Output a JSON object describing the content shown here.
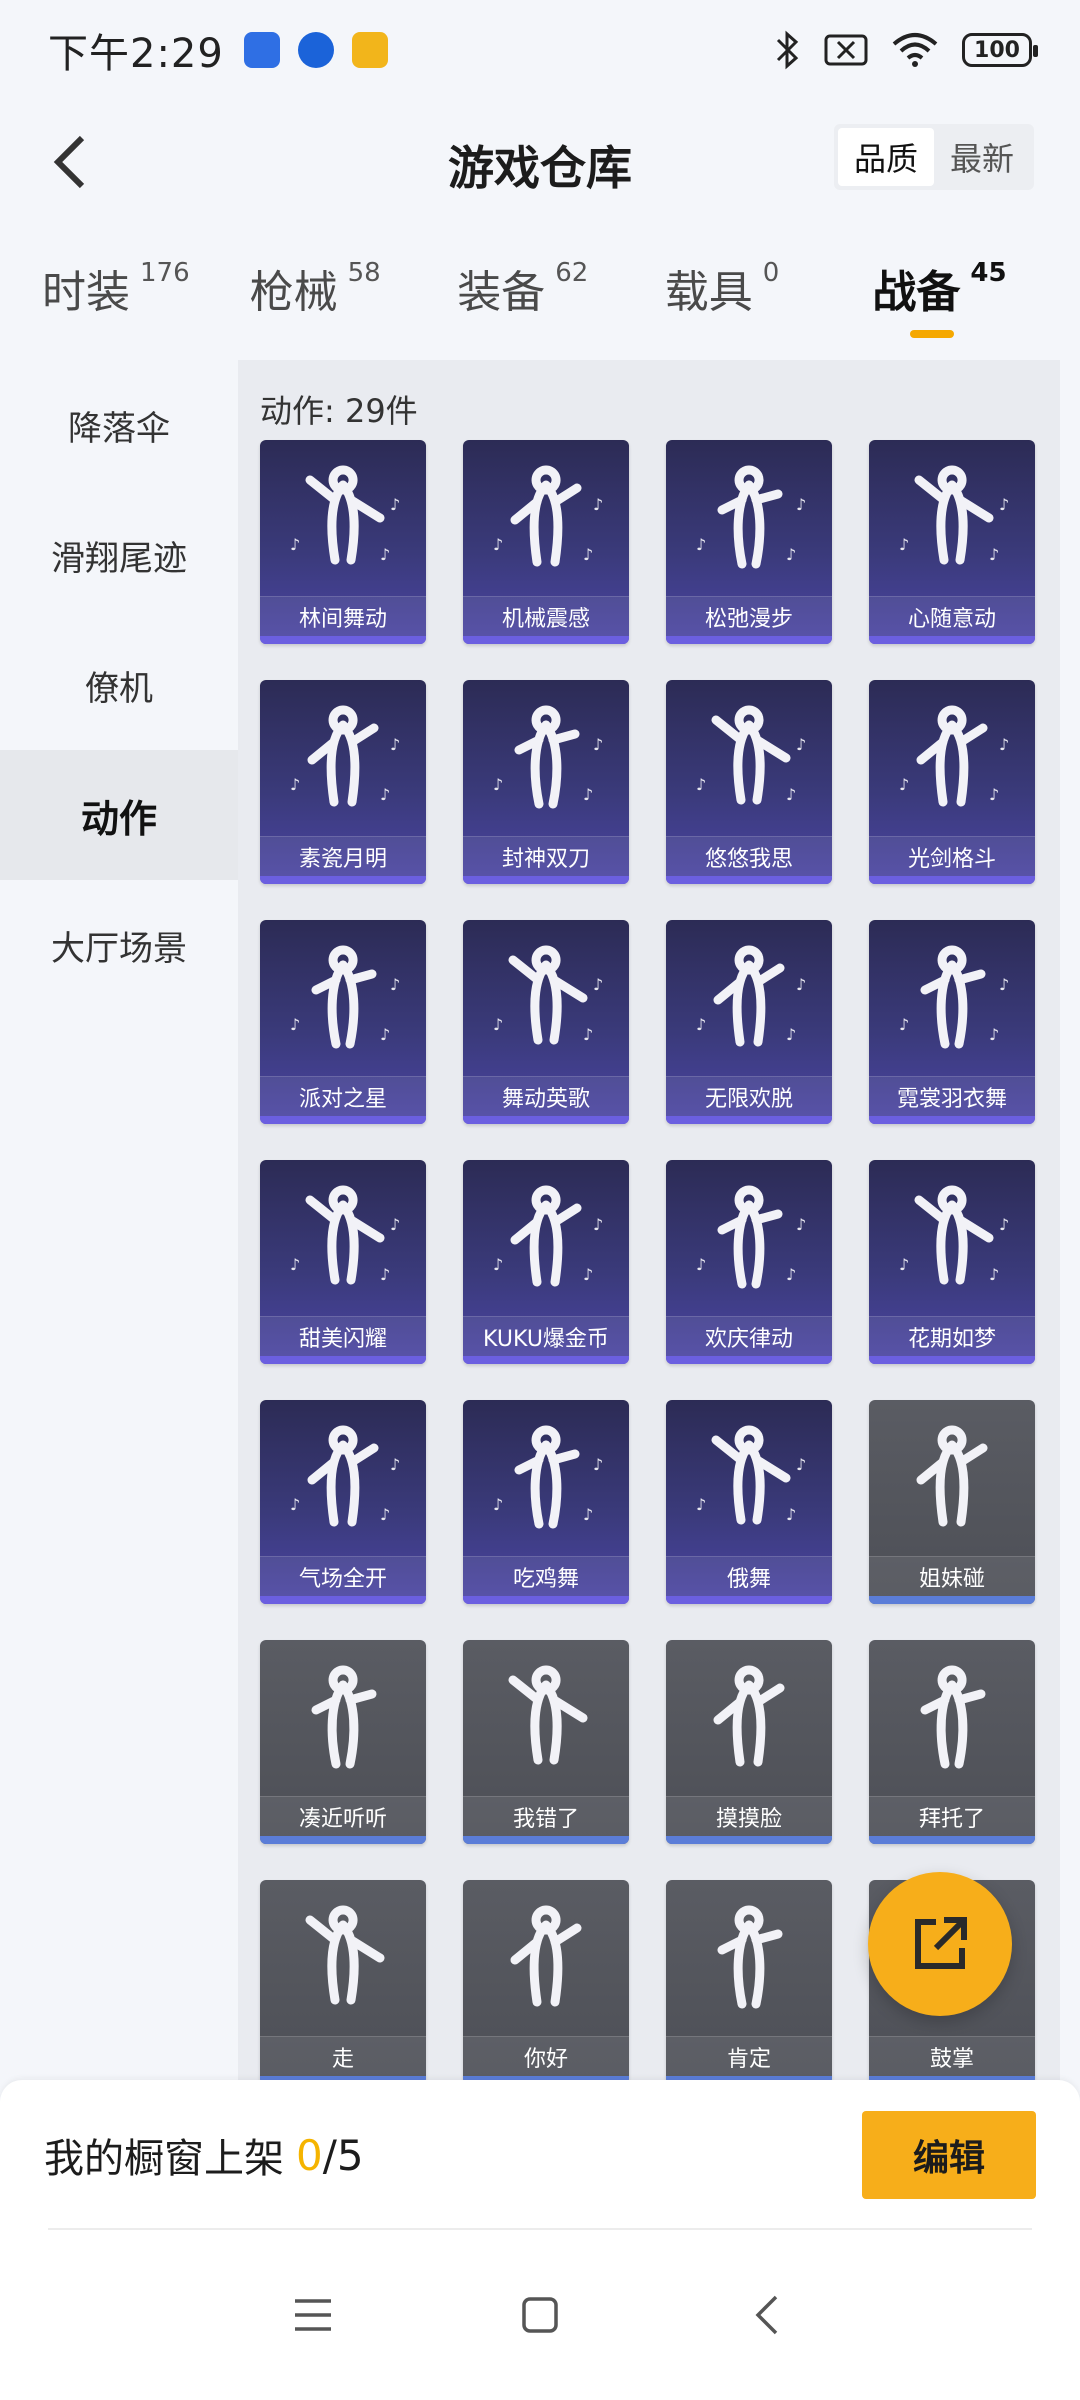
{
  "status_bar": {
    "time": "下午2:29",
    "battery": "100"
  },
  "header": {
    "title": "游戏仓库",
    "sort": [
      "品质",
      "最新"
    ],
    "sort_active": 0
  },
  "tabs": [
    {
      "label": "时装",
      "count": "176"
    },
    {
      "label": "枪械",
      "count": "58"
    },
    {
      "label": "装备",
      "count": "62"
    },
    {
      "label": "载具",
      "count": "0"
    },
    {
      "label": "战备",
      "count": "45"
    }
  ],
  "active_tab": 4,
  "sidebar": {
    "items": [
      "降落伞",
      "滑翔尾迹",
      "僚机",
      "动作",
      "大厅场景"
    ],
    "active": 3
  },
  "content": {
    "count_label": "动作: 29件",
    "items": [
      "林间舞动",
      "机械震感",
      "松弛漫步",
      "心随意动",
      "素瓷月明",
      "封神双刀",
      "悠悠我思",
      "光剑格斗",
      "派对之星",
      "舞动英歌",
      "无限欢脱",
      "霓裳羽衣舞",
      "甜美闪耀",
      "KUKU爆金币",
      "欢庆律动",
      "花期如梦",
      "气场全开",
      "吃鸡舞",
      "俄舞",
      "姐妹碰",
      "凑近听听",
      "我错了",
      "摸摸脸",
      "拜托了",
      "走",
      "你好",
      "肯定",
      "鼓掌"
    ]
  },
  "shelf": {
    "title": "我的橱窗上架",
    "used": "0",
    "sep": "/",
    "total": "5",
    "edit_label": "编辑"
  },
  "colors": {
    "accent": "#f7ae1a",
    "card_purple": "#3a3a7a",
    "card_gray": "#55575e"
  }
}
